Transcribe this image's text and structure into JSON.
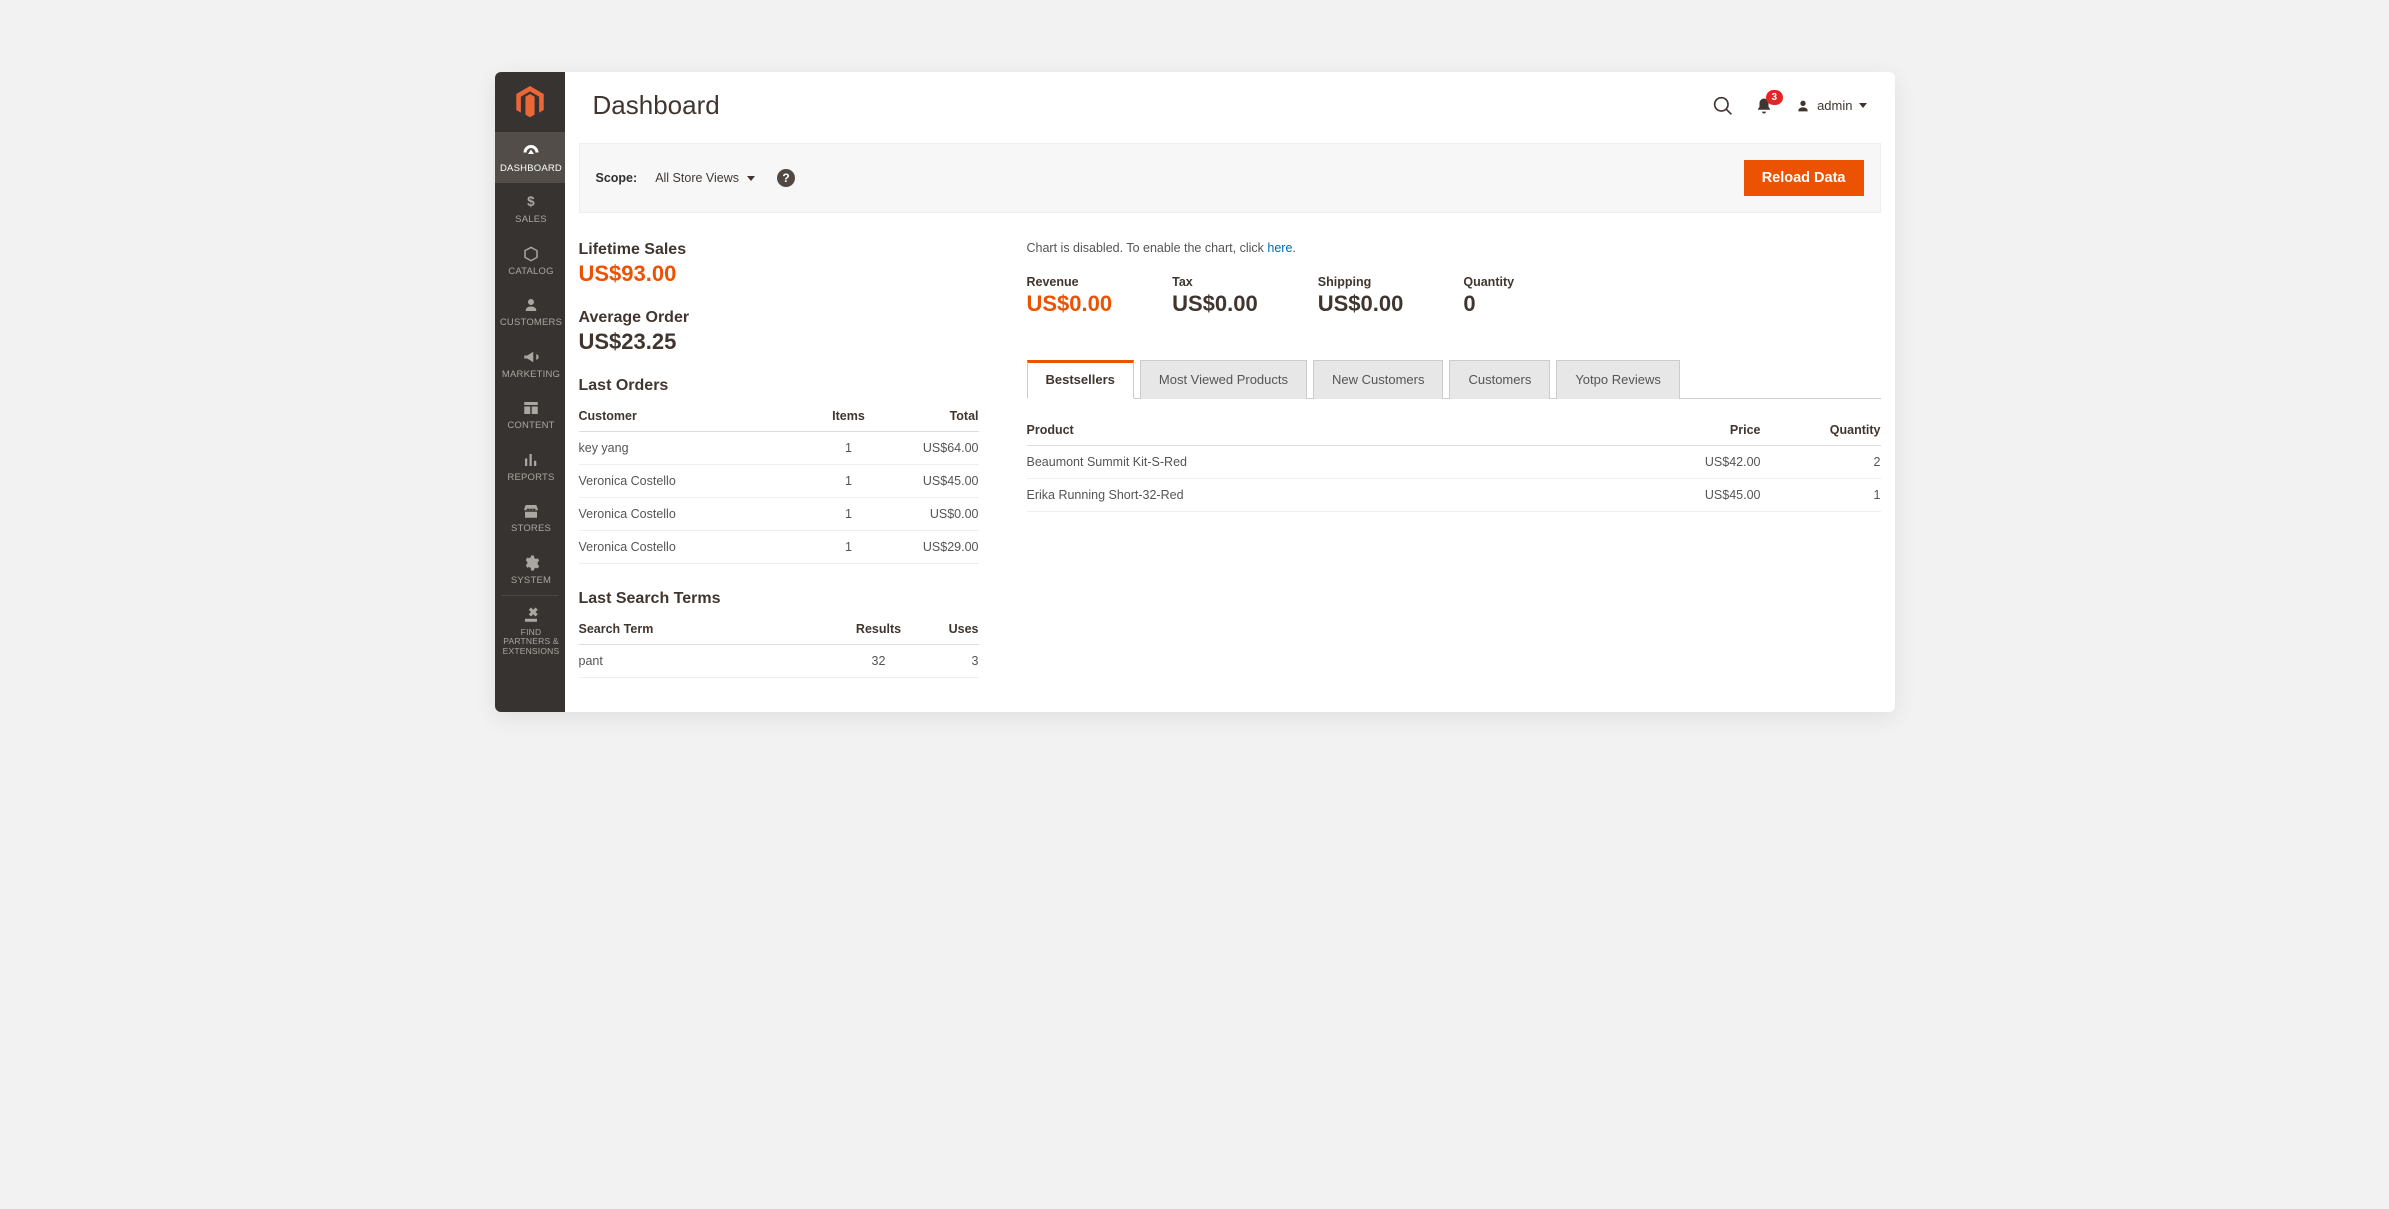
{
  "sidebar": {
    "items": [
      {
        "label": "DASHBOARD",
        "icon": "gauge"
      },
      {
        "label": "SALES",
        "icon": "dollar"
      },
      {
        "label": "CATALOG",
        "icon": "box"
      },
      {
        "label": "CUSTOMERS",
        "icon": "person"
      },
      {
        "label": "MARKETING",
        "icon": "megaphone"
      },
      {
        "label": "CONTENT",
        "icon": "layout"
      },
      {
        "label": "REPORTS",
        "icon": "bars"
      },
      {
        "label": "STORES",
        "icon": "storefront"
      },
      {
        "label": "SYSTEM",
        "icon": "gear"
      },
      {
        "label": "FIND PARTNERS & EXTENSIONS",
        "icon": "partners"
      }
    ]
  },
  "header": {
    "title": "Dashboard",
    "notifications_count": "3",
    "user_name": "admin"
  },
  "scope": {
    "label": "Scope:",
    "selected": "All Store Views",
    "reload_label": "Reload Data"
  },
  "left": {
    "lifetime_label": "Lifetime Sales",
    "lifetime_value": "US$93.00",
    "avg_label": "Average Order",
    "avg_value": "US$23.25",
    "last_orders": {
      "title": "Last Orders",
      "cols": {
        "c0": "Customer",
        "c1": "Items",
        "c2": "Total"
      },
      "rows": [
        {
          "customer": "key yang",
          "items": "1",
          "total": "US$64.00"
        },
        {
          "customer": "Veronica Costello",
          "items": "1",
          "total": "US$45.00"
        },
        {
          "customer": "Veronica Costello",
          "items": "1",
          "total": "US$0.00"
        },
        {
          "customer": "Veronica Costello",
          "items": "1",
          "total": "US$29.00"
        }
      ]
    },
    "last_search": {
      "title": "Last Search Terms",
      "cols": {
        "c0": "Search Term",
        "c1": "Results",
        "c2": "Uses"
      },
      "rows": [
        {
          "term": "pant",
          "results": "32",
          "uses": "3"
        }
      ]
    }
  },
  "right": {
    "chart_note_pre": "Chart is disabled. To enable the chart, click ",
    "chart_note_link": "here",
    "chart_note_post": ".",
    "metrics": [
      {
        "label": "Revenue",
        "value": "US$0.00",
        "accent": true
      },
      {
        "label": "Tax",
        "value": "US$0.00",
        "accent": false
      },
      {
        "label": "Shipping",
        "value": "US$0.00",
        "accent": false
      },
      {
        "label": "Quantity",
        "value": "0",
        "accent": false
      }
    ],
    "tabs": [
      {
        "label": "Bestsellers"
      },
      {
        "label": "Most Viewed Products"
      },
      {
        "label": "New Customers"
      },
      {
        "label": "Customers"
      },
      {
        "label": "Yotpo Reviews"
      }
    ],
    "bestsellers": {
      "cols": {
        "c0": "Product",
        "c1": "Price",
        "c2": "Quantity"
      },
      "rows": [
        {
          "product": "Beaumont Summit Kit-S-Red",
          "price": "US$42.00",
          "qty": "2"
        },
        {
          "product": "Erika Running Short-32-Red",
          "price": "US$45.00",
          "qty": "1"
        }
      ]
    }
  }
}
